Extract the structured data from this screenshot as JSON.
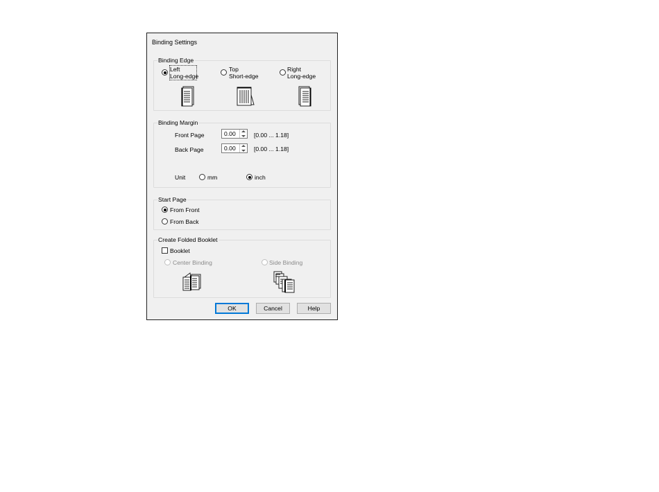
{
  "dialog": {
    "title": "Binding Settings"
  },
  "binding_edge": {
    "label": "Binding Edge",
    "options": [
      {
        "line1": "Left",
        "line2": "Long-edge",
        "selected": true
      },
      {
        "line1": "Top",
        "line2": "Short-edge",
        "selected": false
      },
      {
        "line1": "Right",
        "line2": "Long-edge",
        "selected": false
      }
    ]
  },
  "binding_margin": {
    "label": "Binding Margin",
    "front_page": {
      "label": "Front Page",
      "value": "0.00",
      "range": "[0.00 ... 1.18]"
    },
    "back_page": {
      "label": "Back Page",
      "value": "0.00",
      "range": "[0.00 ... 1.18]"
    },
    "unit": {
      "label": "Unit",
      "options": [
        {
          "label": "mm",
          "selected": false
        },
        {
          "label": "inch",
          "selected": true
        }
      ]
    }
  },
  "start_page": {
    "label": "Start Page",
    "options": [
      {
        "label": "From Front",
        "selected": true
      },
      {
        "label": "From Back",
        "selected": false
      }
    ]
  },
  "folded_booklet": {
    "label": "Create Folded Booklet",
    "booklet_checkbox": {
      "label": "Booklet",
      "checked": false
    },
    "options": [
      {
        "label": "Center Binding",
        "enabled": false
      },
      {
        "label": "Side Binding",
        "enabled": false
      }
    ]
  },
  "buttons": {
    "ok": "OK",
    "cancel": "Cancel",
    "help": "Help"
  },
  "icons": {
    "left_edge": "left-binding-page-icon",
    "top_edge": "top-binding-page-icon",
    "right_edge": "right-binding-page-icon",
    "center_binding": "center-binding-booklet-icon",
    "side_binding": "side-binding-booklet-icon"
  }
}
